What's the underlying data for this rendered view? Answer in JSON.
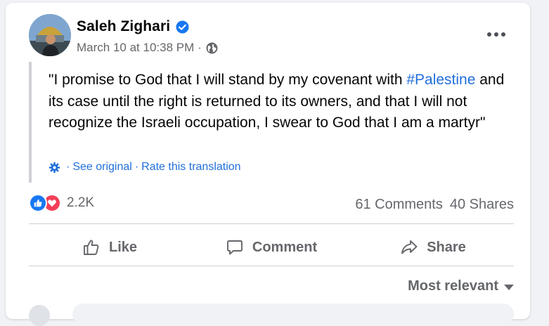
{
  "post": {
    "author": "Saleh Zighari",
    "date": "March 10 at 10:38 PM",
    "dot": "·",
    "text_quote_open": "\"I promise to God that I will stand by my covenant with ",
    "hashtag": "#Palestine",
    "text_rest": " and its case until the right is returned to its owners, and that I will not recognize the Israeli occupation, I swear to God that I am a martyr\"",
    "see_original": "See original",
    "rate_translation": "Rate this translation",
    "translation_sep": "·"
  },
  "reactions": {
    "count": "2.2K",
    "comments": "61 Comments",
    "shares": "40 Shares"
  },
  "actions": {
    "like": "Like",
    "comment": "Comment",
    "share": "Share"
  },
  "sort": {
    "label": "Most relevant"
  },
  "colors": {
    "link": "#216fdb",
    "like_blue": "#1877f2",
    "love_red": "#f33e58",
    "secondary_text": "#65676b"
  },
  "icons": [
    "verified-badge-icon",
    "globe-icon",
    "more-options-icon",
    "gear-icon",
    "like-reaction-icon",
    "love-reaction-icon",
    "thumbs-up-icon",
    "comment-bubble-icon",
    "share-arrow-icon",
    "caret-down-icon"
  ]
}
